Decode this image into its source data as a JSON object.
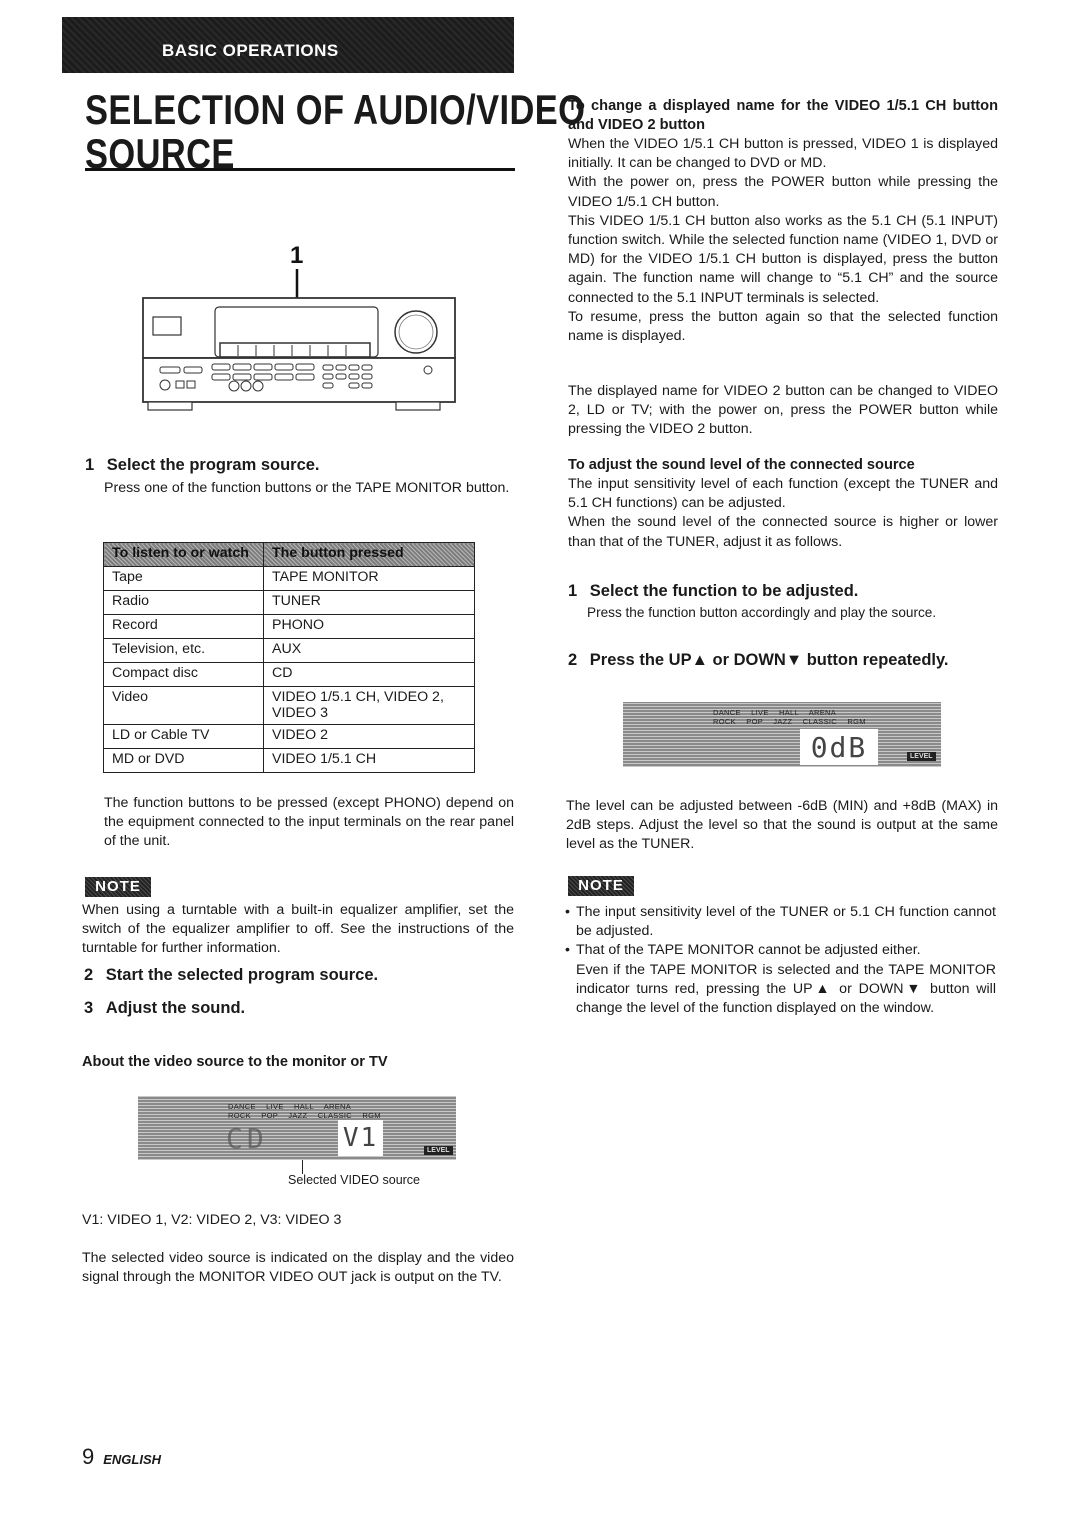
{
  "header": {
    "section": "BASIC OPERATIONS",
    "title_line1": "SELECTION OF AUDIO/VIDEO",
    "title_line2": "SOURCE"
  },
  "illustration": {
    "callout": "1",
    "icon": "stereo-receiver-icon"
  },
  "left": {
    "step1": {
      "num": "1",
      "title": "Select the program source.",
      "body": "Press one of the function buttons or the TAPE MONITOR button."
    },
    "table": {
      "headers": [
        "To listen to or watch",
        "The button pressed"
      ],
      "rows": [
        [
          "Tape",
          "TAPE MONITOR"
        ],
        [
          "Radio",
          "TUNER"
        ],
        [
          "Record",
          "PHONO"
        ],
        [
          "Television, etc.",
          "AUX"
        ],
        [
          "Compact disc",
          "CD"
        ],
        [
          "Video",
          "VIDEO 1/5.1 CH, VIDEO 2, VIDEO 3"
        ],
        [
          "LD or Cable TV",
          "VIDEO 2"
        ],
        [
          "MD or DVD",
          "VIDEO 1/5.1 CH"
        ]
      ]
    },
    "after_table": "The function buttons to be pressed (except PHONO) depend on the equipment connected to the input terminals on the rear panel of the unit.",
    "note_label": "NOTE",
    "note_text": "When using a turntable with a built-in equalizer amplifier, set the switch of the equalizer amplifier to off. See the instructions of the turntable for further information.",
    "step2": {
      "num": "2",
      "title": "Start the selected program source."
    },
    "step3": {
      "num": "3",
      "title": "Adjust the sound."
    },
    "video_heading": "About the video source to the monitor or TV",
    "display": {
      "modes_row1": [
        "DANCE",
        "LIVE",
        "HALL",
        "ARENA"
      ],
      "modes_row2": [
        "ROCK",
        "POP",
        "JAZZ",
        "CLASSIC",
        "RGM"
      ],
      "left_readout": "CD",
      "readout": "V1",
      "chip": "LEVEL"
    },
    "display_caption": "Selected VIDEO source",
    "legend": "V1: VIDEO 1, V2: VIDEO 2, V3: VIDEO 3",
    "closing": "The selected video source is indicated on the display and the video signal through the MONITOR VIDEO OUT jack is output on the TV."
  },
  "right": {
    "change_heading": "To change a displayed name for the VIDEO 1/5.1 CH button and VIDEO 2 button",
    "change_body": [
      "When the VIDEO 1/5.1 CH button is pressed, VIDEO 1 is displayed initially. It can be changed to DVD or MD.",
      "With the power on, press the POWER button while pressing the VIDEO 1/5.1 CH button.",
      "This VIDEO 1/5.1 CH button also works as the 5.1 CH (5.1 INPUT) function switch. While the selected function name (VIDEO 1, DVD or MD) for the VIDEO 1/5.1 CH button is displayed, press the button again. The function name will change to “5.1 CH” and the source connected to the 5.1 INPUT terminals is selected.",
      "To resume, press the button again so that the selected function name is displayed."
    ],
    "video2_body": "The displayed name for VIDEO 2 button can be changed to VIDEO 2, LD or TV; with the power on, press the POWER button while pressing the VIDEO 2 button.",
    "adjust_heading": "To adjust the sound level of the connected source",
    "adjust_body": [
      "The input sensitivity level of each function (except the TUNER and 5.1 CH functions) can be adjusted.",
      "When the sound level of the connected source is higher or lower than that of the TUNER, adjust it as follows."
    ],
    "step1": {
      "num": "1",
      "title": "Select the function to be adjusted.",
      "body": "Press the function button accordingly and play the source."
    },
    "step2": {
      "num": "2",
      "title": "Press the UP▲ or DOWN▼ button repeatedly."
    },
    "display": {
      "modes_row1": [
        "DANCE",
        "LIVE",
        "HALL",
        "ARENA"
      ],
      "modes_row2": [
        "ROCK",
        "POP",
        "JAZZ",
        "CLASSIC",
        "RGM"
      ],
      "readout": "0dB",
      "chip": "LEVEL"
    },
    "level_text": "The level can be adjusted between -6dB (MIN) and +8dB (MAX) in 2dB steps. Adjust the level so that the sound is output at the same level as the TUNER.",
    "note_label": "NOTE",
    "note_items": [
      "The input sensitivity level of the TUNER or 5.1 CH function cannot be adjusted.",
      "That of the TAPE MONITOR cannot be adjusted either."
    ],
    "note_continuation": "Even if the TAPE MONITOR is selected and the TAPE MONITOR indicator turns red, pressing the UP▲ or DOWN▼ button will change the level of the function displayed on the window."
  },
  "footer": {
    "page_number": "9",
    "language": "ENGLISH"
  }
}
